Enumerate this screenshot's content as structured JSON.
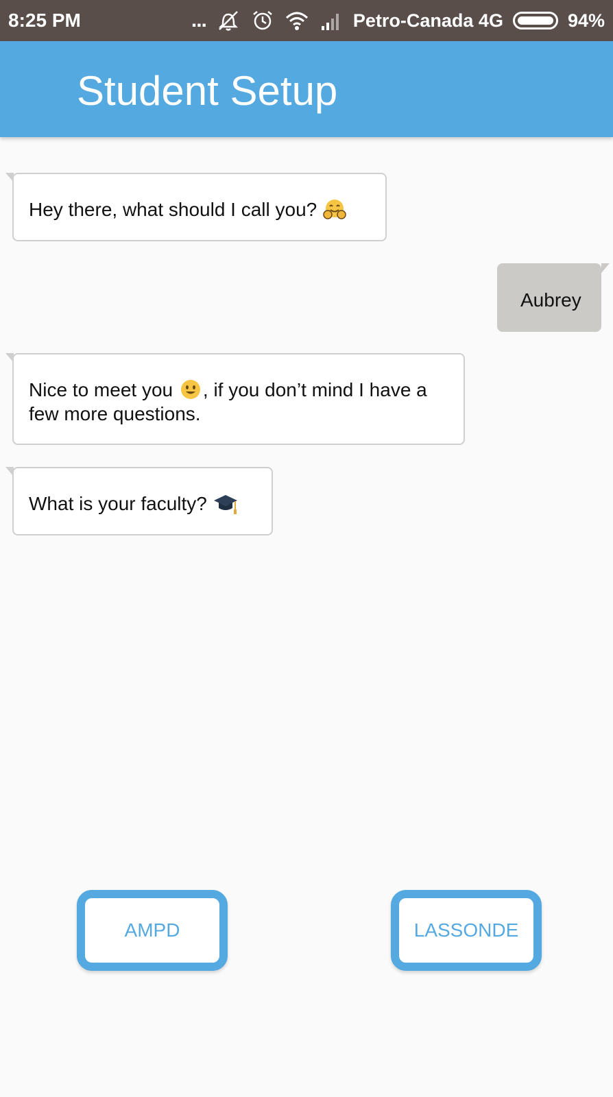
{
  "status_bar": {
    "time": "8:25 PM",
    "dots": "...",
    "carrier": "Petro-Canada 4G",
    "battery": "94%",
    "icons": [
      "more-dots-icon",
      "vibrate-off-icon",
      "alarm-icon",
      "wifi-icon",
      "signal-icon",
      "battery-icon"
    ]
  },
  "app_bar": {
    "title": "Student Setup",
    "color": "#55a9e1"
  },
  "messages": [
    {
      "sender": "bot",
      "text": "Hey there, what should I call you?",
      "emoji": "hugging-face-icon"
    },
    {
      "sender": "user",
      "text": "Aubrey"
    },
    {
      "sender": "bot",
      "text_before": "Nice to meet you",
      "emoji": "smiling-face-icon",
      "text_after": ", if you don’t mind I have a few more questions."
    },
    {
      "sender": "bot",
      "text": "What is your faculty?",
      "emoji": "graduation-cap-icon"
    }
  ],
  "choices": [
    {
      "label": "AMPD"
    },
    {
      "label": "LASSONDE"
    }
  ]
}
